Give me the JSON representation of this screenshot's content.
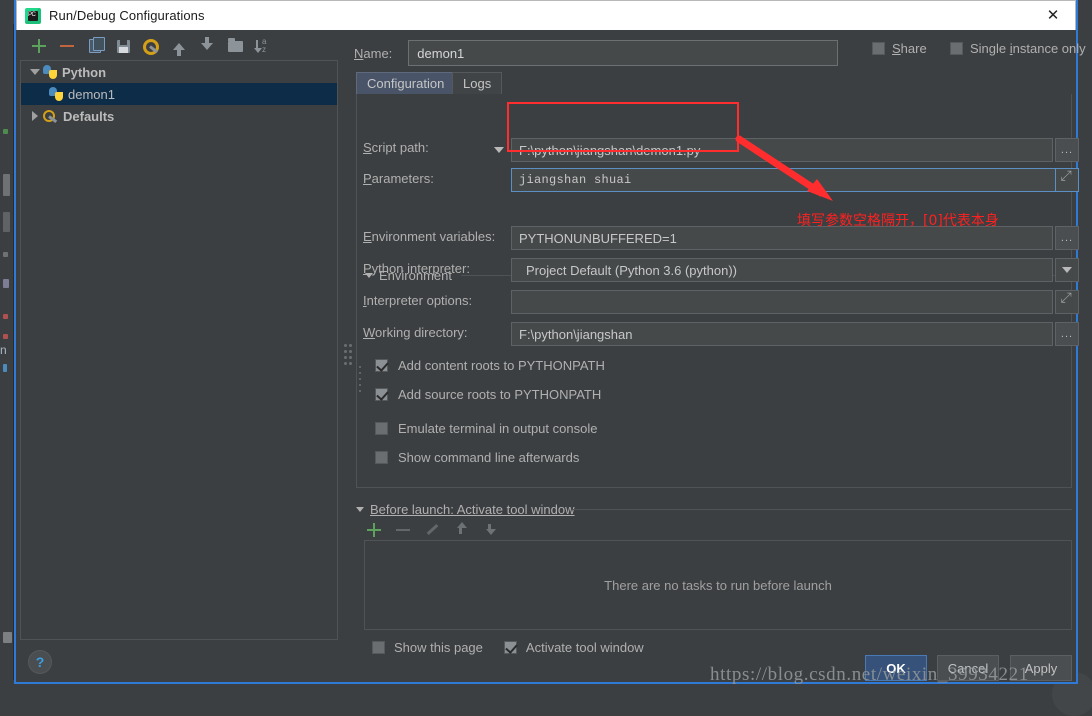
{
  "window": {
    "title": "Run/Debug Configurations",
    "icon": "pycharm-icon",
    "close_label": "✕"
  },
  "tree_toolbar": {
    "buttons": [
      {
        "name": "add-configuration-button",
        "icon": "plus-icon"
      },
      {
        "name": "remove-configuration-button",
        "icon": "minus-icon"
      },
      {
        "name": "copy-configuration-button",
        "icon": "copy-icon"
      },
      {
        "name": "save-configuration-button",
        "icon": "save-icon"
      },
      {
        "name": "edit-defaults-button",
        "icon": "wrench-icon"
      },
      {
        "name": "move-up-button",
        "icon": "arrow-up-icon"
      },
      {
        "name": "move-down-button",
        "icon": "arrow-down-icon"
      },
      {
        "name": "create-folder-button",
        "icon": "folder-icon"
      },
      {
        "name": "sort-configurations-button",
        "icon": "sort-az-icon"
      }
    ]
  },
  "tree": {
    "nodes": [
      {
        "label": "Python",
        "icon": "python-icon",
        "expanded": true,
        "selected": false,
        "level": 0
      },
      {
        "label": "demon1",
        "icon": "python-icon",
        "expanded": null,
        "selected": true,
        "level": 1
      },
      {
        "label": "Defaults",
        "icon": "wrench-icon",
        "expanded": false,
        "selected": false,
        "level": 0
      }
    ]
  },
  "form": {
    "name_label": "Name:",
    "name_value": "demon1",
    "share_label": "Share",
    "share_checked": false,
    "single_instance_label": "Single instance only",
    "single_instance_checked": false,
    "tabs": [
      {
        "label": "Configuration",
        "active": true
      },
      {
        "label": "Logs",
        "active": false
      }
    ],
    "script_path_label": "Script path:",
    "script_path_value": "F:\\python\\jiangshan\\demon1.py",
    "parameters_label": "Parameters:",
    "parameters_value": "jiangshan  shuai",
    "environment_label": "Environment",
    "environment_variables_label": "Environment variables:",
    "environment_variables_value": "PYTHONUNBUFFERED=1",
    "python_interpreter_label": "Python interpreter:",
    "python_interpreter_value": "Project Default (Python 3.6 (python))",
    "interpreter_options_label": "Interpreter options:",
    "interpreter_options_value": "",
    "working_directory_label": "Working directory:",
    "working_directory_value": "F:\\python\\jiangshan",
    "browse_label": "...",
    "checkboxes": [
      {
        "label": "Add content roots to PYTHONPATH",
        "checked": true,
        "name": "add-content-roots-checkbox"
      },
      {
        "label": "Add source roots to PYTHONPATH",
        "checked": true,
        "name": "add-source-roots-checkbox"
      },
      {
        "label": "Emulate terminal in output console",
        "checked": false,
        "name": "emulate-terminal-checkbox"
      },
      {
        "label": "Show command line afterwards",
        "checked": false,
        "name": "show-command-line-checkbox"
      }
    ]
  },
  "before_launch": {
    "header": "Before launch: Activate tool window",
    "toolbar": [
      {
        "name": "add-task-button",
        "icon": "plus-icon"
      },
      {
        "name": "remove-task-button",
        "icon": "minus-icon"
      },
      {
        "name": "edit-task-button",
        "icon": "pencil-icon"
      },
      {
        "name": "move-task-up-button",
        "icon": "arrow-up-icon"
      },
      {
        "name": "move-task-down-button",
        "icon": "arrow-down-icon"
      }
    ],
    "empty_text": "There are no tasks to run before launch",
    "show_this_page_label": "Show this page",
    "show_this_page_checked": false,
    "activate_tool_window_label": "Activate tool window",
    "activate_tool_window_checked": true
  },
  "annotation": {
    "note_text": "填写参数空格隔开，[0]代表本身",
    "color": "#ff2020"
  },
  "footer": {
    "help_label": "?",
    "ok_label": "OK",
    "cancel_label": "Cancel",
    "apply_label": "Apply"
  },
  "watermark": {
    "text": "https://blog.csdn.net/weixin_39934221"
  }
}
